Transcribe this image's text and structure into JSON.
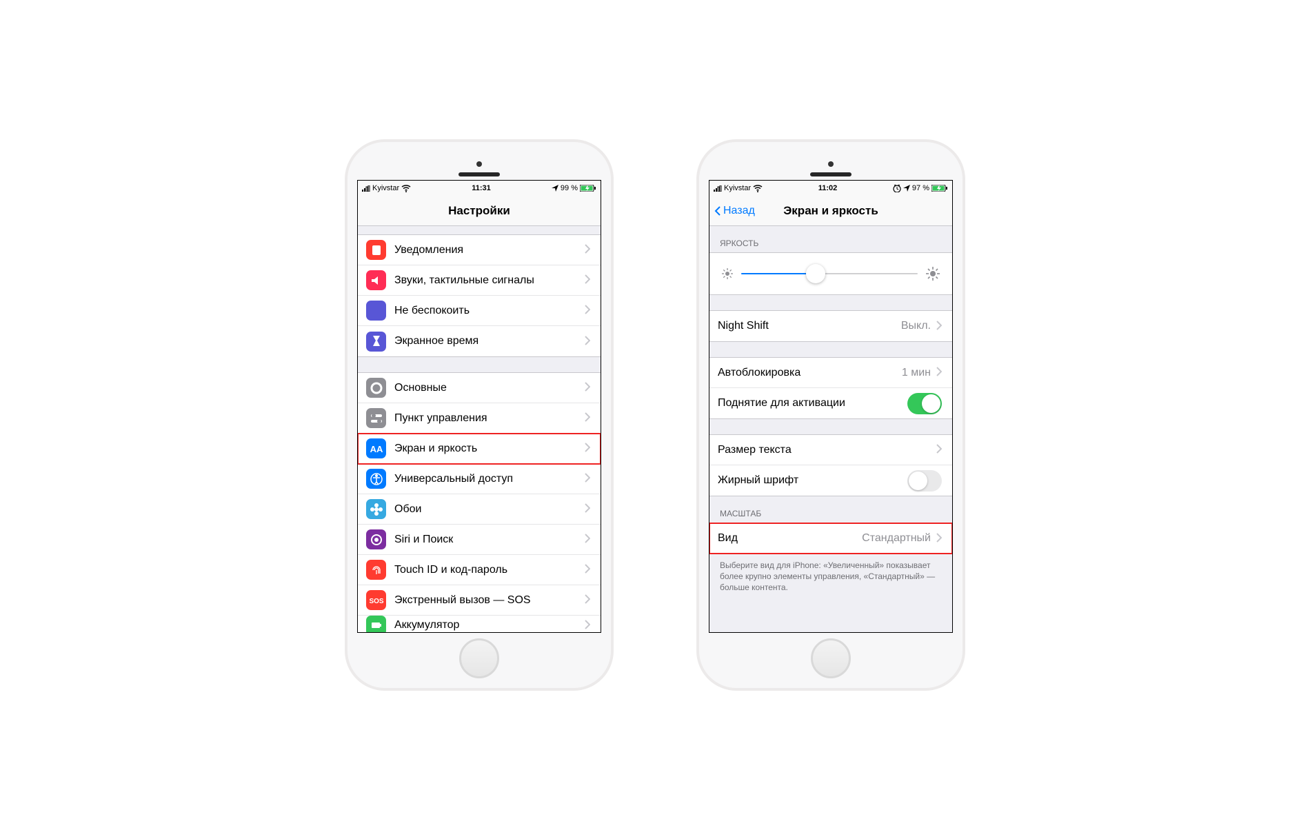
{
  "left": {
    "status": {
      "carrier": "Kyivstar",
      "time": "11:31",
      "battery": "99 %"
    },
    "title": "Настройки",
    "g1": [
      {
        "label": "Уведомления",
        "color": "#ff3b30",
        "svg": "notif"
      },
      {
        "label": "Звуки, тактильные сигналы",
        "color": "#ff2d55",
        "svg": "sound"
      },
      {
        "label": "Не беспокоить",
        "color": "#5856d6",
        "svg": "moon"
      },
      {
        "label": "Экранное время",
        "color": "#5856d6",
        "svg": "hourglass"
      }
    ],
    "g2": [
      {
        "label": "Основные",
        "color": "#8e8e93",
        "svg": "gear"
      },
      {
        "label": "Пункт управления",
        "color": "#8e8e93",
        "svg": "switches"
      },
      {
        "label": "Экран и яркость",
        "color": "#007aff",
        "svg": "aa",
        "hl": true
      },
      {
        "label": "Универсальный доступ",
        "color": "#007aff",
        "svg": "acc"
      },
      {
        "label": "Обои",
        "color": "#36a9e1",
        "svg": "flower"
      },
      {
        "label": "Siri и Поиск",
        "color": "#7c2da0",
        "svg": "siri"
      },
      {
        "label": "Touch ID и код-пароль",
        "color": "#ff3b30",
        "svg": "finger"
      },
      {
        "label": "Экстренный вызов — SOS",
        "color": "#ff3b30",
        "svg": "sos"
      },
      {
        "label": "Аккумулятор",
        "color": "#34c759",
        "svg": "batt"
      }
    ]
  },
  "right": {
    "status": {
      "carrier": "Kyivstar",
      "time": "11:02",
      "battery": "97 %"
    },
    "back": "Назад",
    "title": "Экран и яркость",
    "brightness_label": "ЯРКОСТЬ",
    "brightness_pct": 42,
    "nightshift": {
      "label": "Night Shift",
      "value": "Выкл."
    },
    "autolock": {
      "label": "Автоблокировка",
      "value": "1 мин"
    },
    "raise": {
      "label": "Поднятие для активации",
      "on": true
    },
    "textsize": {
      "label": "Размер текста"
    },
    "bold": {
      "label": "Жирный шрифт",
      "on": false
    },
    "zoom_label": "МАСШТАБ",
    "view": {
      "label": "Вид",
      "value": "Стандартный",
      "hl": true
    },
    "footer": "Выберите вид для iPhone: «Увеличенный» показывает более крупно элементы управления, «Стандартный» — больше контента."
  }
}
